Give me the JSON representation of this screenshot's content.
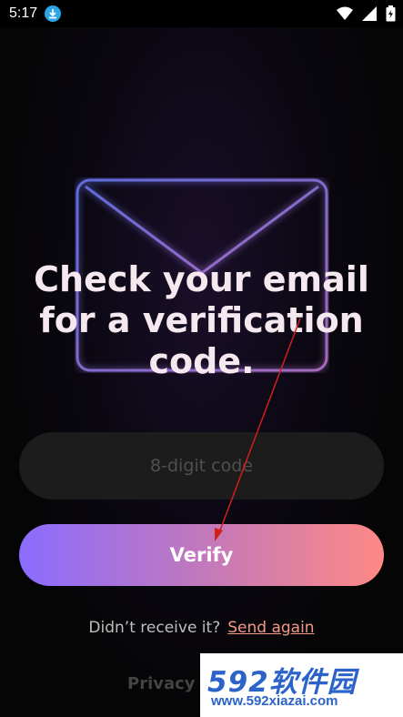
{
  "status_bar": {
    "time": "5:17",
    "icons": [
      "download-icon",
      "wifi-icon",
      "signal-icon",
      "battery-icon"
    ]
  },
  "main": {
    "title": "Check your email for a verification code.",
    "code_input": {
      "placeholder": "8-digit code",
      "value": ""
    },
    "verify_label": "Verify",
    "resend_text": "Didn’t receive it?",
    "resend_link": "Send again",
    "privacy_label": "Privacy"
  },
  "watermark": {
    "logo": "592软件园",
    "url": "www.592xiazai.com"
  },
  "colors": {
    "gradient_start": "#8b6cff",
    "gradient_end": "#ff8985",
    "link": "#f39a84",
    "field_bg": "#1c1c1c"
  }
}
